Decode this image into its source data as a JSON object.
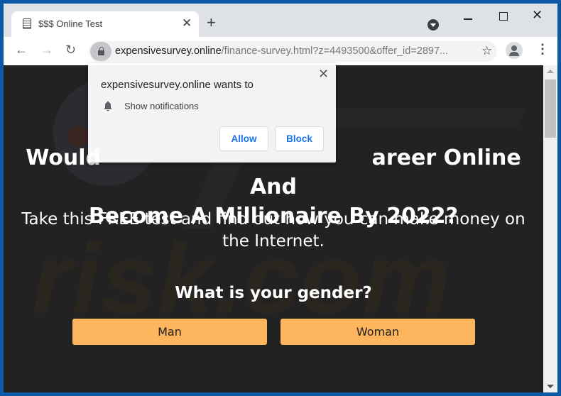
{
  "browser": {
    "tab": {
      "title": "$$$ Online Test",
      "favicon": "document-icon",
      "close_glyph": "✕"
    },
    "new_tab_glyph": "+",
    "window_controls": {
      "minimize": "minimize-icon",
      "maximize": "maximize-icon",
      "close_glyph": "✕"
    },
    "nav": {
      "back_glyph": "←",
      "forward_glyph": "→",
      "reload_glyph": "↻"
    },
    "url": {
      "host": "expensivesurvey.online",
      "path": "/finance-survey.html?z=4493500&offer_id=2897..."
    },
    "star_glyph": "☆",
    "menu_glyph": "⋮"
  },
  "permission_popup": {
    "title": "expensivesurvey.online wants to",
    "permission": "Show notifications",
    "allow_label": "Allow",
    "block_label": "Block",
    "close_glyph": "✕"
  },
  "page": {
    "headline_part1": "Would",
    "headline_hidden": " You Like To Start A Career Online And",
    "headline_visible_tail": "areer Online And",
    "headline_line2": "Become A Millionaire By 2022?",
    "subtitle": "Take this FREE test and find out how you can make money on the Internet.",
    "question": "What is your gender?",
    "answers": [
      "Man",
      "Woman"
    ],
    "watermark": "risk.com",
    "accent_color": "#fdb55e"
  }
}
